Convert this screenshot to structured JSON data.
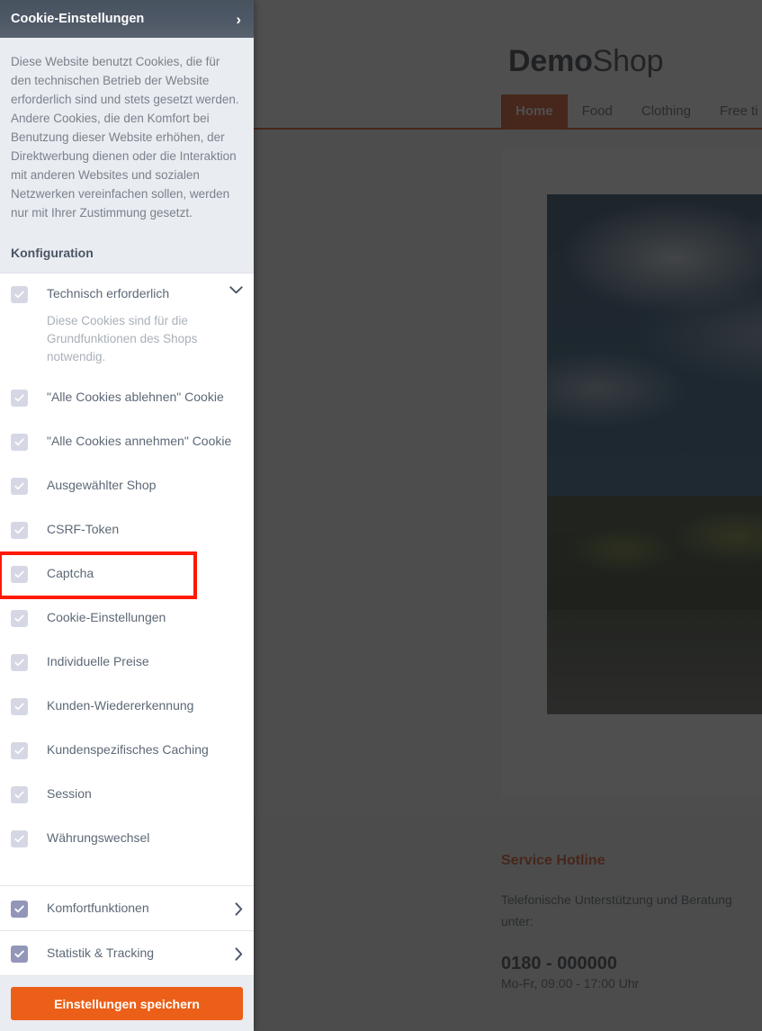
{
  "shop": {
    "logo_bold": "Demo",
    "logo_light": "Shop",
    "nav": [
      {
        "label": "Home",
        "active": true
      },
      {
        "label": "Food",
        "active": false
      },
      {
        "label": "Clothing",
        "active": false
      },
      {
        "label": "Free ti",
        "active": false
      }
    ],
    "footer": {
      "title": "Service Hotline",
      "text": "Telefonische Unterstützung und Beratung unter:",
      "phone": "0180 - 000000",
      "hours": "Mo-Fr, 09:00 - 17:00 Uhr"
    }
  },
  "cookie_panel": {
    "header_title": "Cookie-Einstellungen",
    "header_icon": "chevron-right-icon",
    "intro_text": "Diese Website benutzt Cookies, die für den technischen Betrieb der Website erforderlich sind und stets gesetzt werden. Andere Cookies, die den Komfort bei Benutzung dieser Website erhöhen, der Direktwerbung dienen oder die Interaktion mit anderen Websites und sozialen Netzwerken vereinfachen sollen, werden nur mit Ihrer Zustimmung gesetzt.",
    "konfiguration_title": "Konfiguration",
    "technisch": {
      "label": "Technisch erforderlich",
      "checked": true,
      "disabled": true,
      "expanded": true,
      "description": "Diese Cookies sind für die Grundfunktionen des Shops notwendig."
    },
    "items": [
      {
        "label": "\"Alle Cookies ablehnen\" Cookie",
        "checked": true,
        "disabled": true
      },
      {
        "label": "\"Alle Cookies annehmen\" Cookie",
        "checked": true,
        "disabled": true
      },
      {
        "label": "Ausgewählter Shop",
        "checked": true,
        "disabled": true
      },
      {
        "label": "CSRF-Token",
        "checked": true,
        "disabled": true
      },
      {
        "label": "Captcha",
        "checked": true,
        "disabled": true,
        "highlighted": true
      },
      {
        "label": "Cookie-Einstellungen",
        "checked": true,
        "disabled": true
      },
      {
        "label": "Individuelle Preise",
        "checked": true,
        "disabled": true
      },
      {
        "label": "Kunden-Wiedererkennung",
        "checked": true,
        "disabled": true
      },
      {
        "label": "Kundenspezifisches Caching",
        "checked": true,
        "disabled": true
      },
      {
        "label": "Session",
        "checked": true,
        "disabled": true
      },
      {
        "label": "Währungswechsel",
        "checked": true,
        "disabled": true
      }
    ],
    "groups": [
      {
        "label": "Komfortfunktionen",
        "checked": true,
        "disabled": false
      },
      {
        "label": "Statistik & Tracking",
        "checked": true,
        "disabled": false
      }
    ],
    "save_label": "Einstellungen speichern",
    "colors": {
      "accent_orange": "#ec5f18",
      "header_gray": "#4e5866",
      "highlight_red": "#ff1a00",
      "checkbox_disabled": "#d5d8e4",
      "checkbox_enabled": "#9296b9"
    }
  }
}
